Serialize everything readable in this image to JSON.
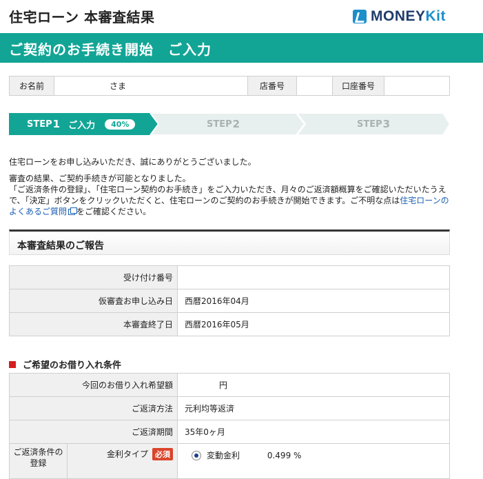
{
  "header": {
    "title": "住宅ローン 本審査結果",
    "logo_main": "MONEY",
    "logo_accent": "Kit"
  },
  "banner": {
    "title": "ご契約のお手続き開始　ご入力"
  },
  "info_bar": {
    "name_label": "お名前",
    "name_suffix": "さま",
    "branch_label": "店番号",
    "branch_value": "",
    "account_label": "口座番号",
    "account_value": ""
  },
  "steps": [
    {
      "prefix": "STEP",
      "num": "1",
      "title": "ご入力",
      "progress": "40%",
      "active": true
    },
    {
      "prefix": "STEP",
      "num": "2",
      "active": false
    },
    {
      "prefix": "STEP",
      "num": "3",
      "active": false
    }
  ],
  "intro": {
    "line1": "住宅ローンをお申し込みいただき、誠にありがとうございました。",
    "line2": "審査の結果、ご契約手続きが可能となりました。",
    "line3a": "「ご返済条件の登録」、「住宅ローン契約のお手続き」をご入力いただき、月々のご返済額概算をご確認いただいたうえで、「決定」ボタンをクリックいただくと、住宅ローンのご契約のお手続きが開始できます。ご不明な点は",
    "link": "住宅ローンのよくあるご質問",
    "line3b": "をご確認ください。"
  },
  "report": {
    "title": "本審査結果のご報告",
    "rows": [
      {
        "label": "受け付け番号",
        "value": ""
      },
      {
        "label": "仮審査お申し込み日",
        "value": "西暦2016年04月"
      },
      {
        "label": "本審査終了日",
        "value": "西暦2016年05月"
      }
    ]
  },
  "conditions": {
    "title": "ご希望のお借り入れ条件",
    "rows": [
      {
        "label": "今回のお借り入れ希望額",
        "value": "円"
      },
      {
        "label": "ご返済方法",
        "value": "元利均等返済"
      },
      {
        "label": "ご返済期間",
        "value": "35年0ヶ月"
      }
    ],
    "registration": {
      "group_label": "ご返済条件の登録",
      "rate_type_label": "金利タイプ",
      "required": "必須",
      "option_label": "変動金利",
      "option_rate": "0.499 %"
    }
  },
  "colors": {
    "brand": "#12a596",
    "step_inactive": "#e8efef",
    "required": "#d9452b"
  }
}
